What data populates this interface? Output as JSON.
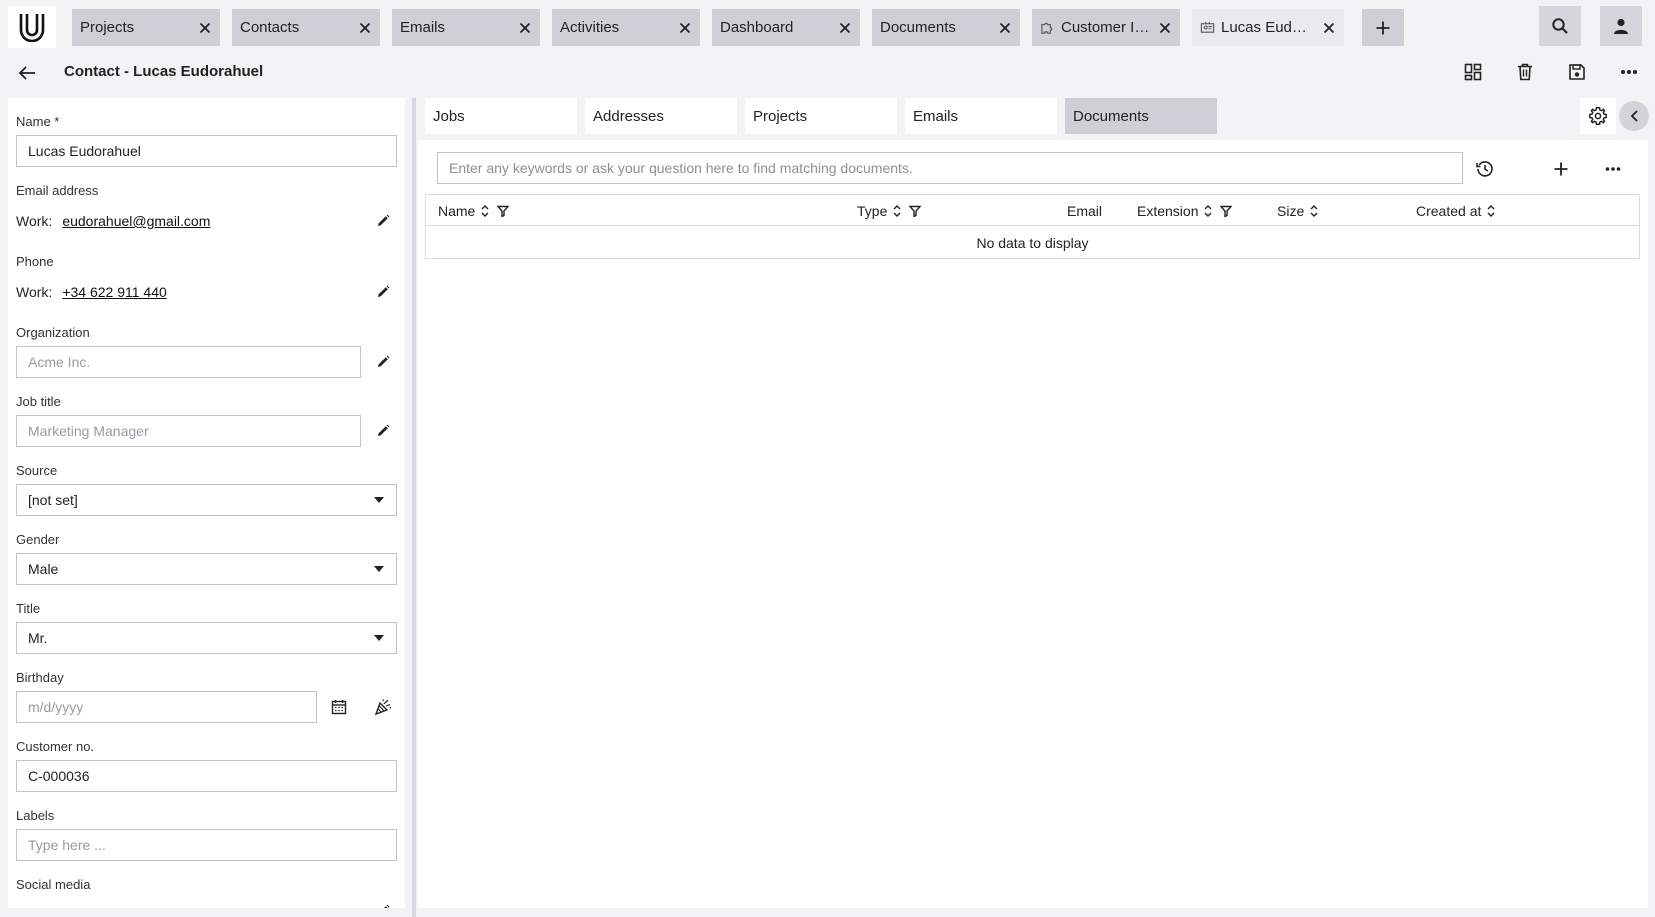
{
  "tabs": [
    {
      "label": "Projects",
      "icon": null
    },
    {
      "label": "Contacts",
      "icon": null
    },
    {
      "label": "Emails",
      "icon": null
    },
    {
      "label": "Activities",
      "icon": null
    },
    {
      "label": "Dashboard",
      "icon": null
    },
    {
      "label": "Documents",
      "icon": null
    },
    {
      "label": "Customer Insi...",
      "icon": "puzzle-icon"
    },
    {
      "label": "Lucas Eudora...",
      "icon": "contact-card-icon"
    }
  ],
  "header": {
    "title": "Contact - Lucas Eudorahuel"
  },
  "form": {
    "name_label": "Name *",
    "name_value": "Lucas Eudorahuel",
    "email_label": "Email address",
    "email_type": "Work:",
    "email_value": "eudorahuel@gmail.com",
    "phone_label": "Phone",
    "phone_type": "Work:",
    "phone_value": "+34 622 911 440",
    "organization_label": "Organization",
    "organization_placeholder": "Acme Inc.",
    "job_title_label": "Job title",
    "job_title_placeholder": "Marketing Manager",
    "source_label": "Source",
    "source_value": "[not set]",
    "gender_label": "Gender",
    "gender_value": "Male",
    "title_label": "Title",
    "title_value": "Mr.",
    "birthday_label": "Birthday",
    "birthday_placeholder": "m/d/yyyy",
    "customer_no_label": "Customer no.",
    "customer_no_value": "C-000036",
    "labels_label": "Labels",
    "labels_placeholder": "Type here ...",
    "social_media_label": "Social media"
  },
  "right_tabs": [
    {
      "label": "Jobs"
    },
    {
      "label": "Addresses"
    },
    {
      "label": "Projects"
    },
    {
      "label": "Emails"
    },
    {
      "label": "Documents"
    }
  ],
  "documents": {
    "search_placeholder": "Enter any keywords or ask your question here to find matching documents.",
    "columns": [
      "Name",
      "Type",
      "Email",
      "Extension",
      "Size",
      "Created at"
    ],
    "empty_text": "No data to display"
  },
  "colors": {
    "tab_bg": "#cfcfd8",
    "active_tab_bg": "#e9e9ee",
    "page_bg": "#f3f3f6"
  }
}
